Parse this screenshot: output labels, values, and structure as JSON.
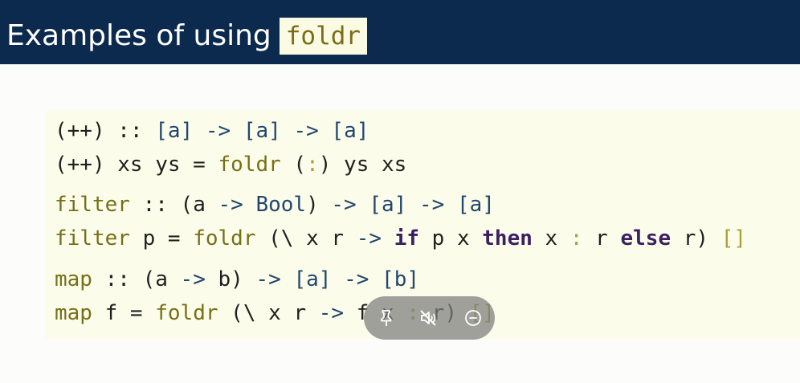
{
  "slide": {
    "title": "Examples of using",
    "title_code": "foldr"
  },
  "code": {
    "l1": [
      "(++)",
      " :: ",
      "[a] ",
      "->",
      " [a] ",
      "->",
      " [a]"
    ],
    "l2": [
      "(++) xs ys = ",
      "foldr",
      " (",
      ":",
      ") ys xs"
    ],
    "l3": [
      "filter",
      " :: (a ",
      "->",
      " ",
      "Bool",
      ") ",
      "->",
      " [a] ",
      "->",
      " [a]"
    ],
    "l4": [
      "filter",
      " p = ",
      "foldr",
      " (\\ x r ",
      "->",
      " ",
      "if",
      " p x ",
      "then",
      " x ",
      ":",
      " r ",
      "else",
      " r) ",
      "[]"
    ],
    "l5": [
      "map",
      " :: (a ",
      "->",
      " b) ",
      "->",
      " [a] ",
      "->",
      " [b]"
    ],
    "l6": [
      "map",
      " f = ",
      "foldr",
      " (\\ x r ",
      "->",
      " f x ",
      ":",
      " r) ",
      "[]"
    ]
  },
  "overlay": {
    "icons": [
      "pin-icon",
      "mute-icon",
      "minimize-icon"
    ]
  },
  "colors": {
    "header_bg": "#0c2a4d",
    "code_bg": "#fcfcea",
    "name": "#767018",
    "keyword": "#3c1f63",
    "operator": "#22476f"
  }
}
